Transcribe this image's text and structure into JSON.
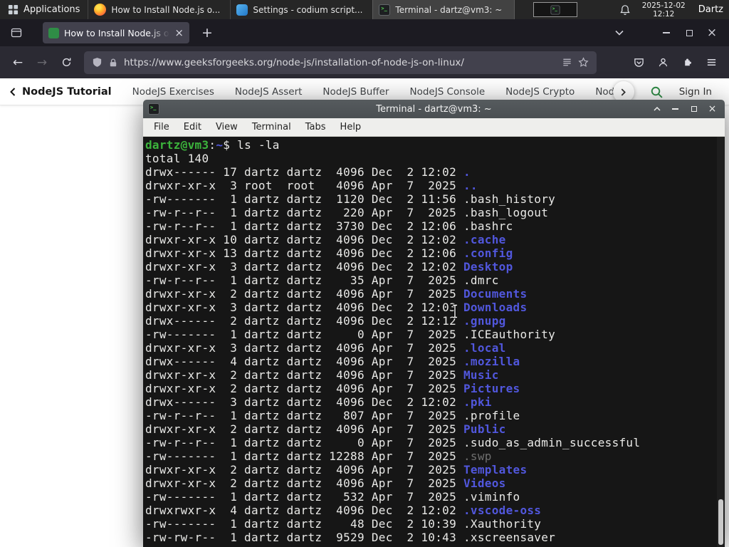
{
  "colors": {
    "panel_bg": "#262626",
    "tabbar_bg": "#1c1b22",
    "toolbar_bg": "#2b2a33",
    "urlbar_bg": "#42414d",
    "gfg_green": "#2f8d46",
    "titlebar_bg": "#4a4f52",
    "menubar_bg": "#eeeeec",
    "term_bg": "#161616",
    "term_fg": "#e9e9e7",
    "term_green": "#3cb43c",
    "term_blue": "#5157dd",
    "term_dim": "#6f6f6f"
  },
  "glyphs": {
    "close": "×",
    "plus": "+",
    "back": "←",
    "forward": "→"
  },
  "panel": {
    "applications_label": "Applications",
    "tasks": [
      {
        "label": "How to Install Node.js o...",
        "icon": "firefox-icon"
      },
      {
        "label": "Settings - codium script...",
        "icon": "codium-icon"
      },
      {
        "label": "Terminal - dartz@vm3: ~",
        "icon": "terminal-icon"
      }
    ],
    "clock_date": "2025-12-02",
    "clock_time": "12:12",
    "user": "Dartz"
  },
  "browser": {
    "tab_title": "How to Install Node.js on",
    "url": "https://www.geeksforgeeks.org/node-js/installation-of-node-js-on-linux/"
  },
  "gfg": {
    "primary": "NodeJS Tutorial",
    "links": [
      "NodeJS Exercises",
      "NodeJS Assert",
      "NodeJS Buffer",
      "NodeJS Console",
      "NodeJS Crypto",
      "NodeJS DNS",
      "Node"
    ],
    "sign_in": "Sign In"
  },
  "terminal_window": {
    "title": "Terminal - dartz@vm3: ~",
    "menus": [
      "File",
      "Edit",
      "View",
      "Terminal",
      "Tabs",
      "Help"
    ]
  },
  "terminal": {
    "prompt": "dartz@vm3:~$",
    "command": "ls -la",
    "lines": [
      [
        {
          "t": "dartz@vm3",
          "c": "green"
        },
        {
          "t": ":",
          "c": "fg"
        },
        {
          "t": "~",
          "c": "blue"
        },
        {
          "t": "$ ls -la",
          "c": "fg"
        }
      ],
      [
        {
          "t": "total 140",
          "c": "fg"
        }
      ],
      [
        {
          "t": "drwx------ 17 dartz dartz  4096 Dec  2 12:02 ",
          "c": "fg"
        },
        {
          "t": ".",
          "c": "blue"
        }
      ],
      [
        {
          "t": "drwxr-xr-x  3 root  root   4096 Apr  7  2025 ",
          "c": "fg"
        },
        {
          "t": "..",
          "c": "blue"
        }
      ],
      [
        {
          "t": "-rw-------  1 dartz dartz  1120 Dec  2 11:56 .bash_history",
          "c": "fg"
        }
      ],
      [
        {
          "t": "-rw-r--r--  1 dartz dartz   220 Apr  7  2025 .bash_logout",
          "c": "fg"
        }
      ],
      [
        {
          "t": "-rw-r--r--  1 dartz dartz  3730 Dec  2 12:06 .bashrc",
          "c": "fg"
        }
      ],
      [
        {
          "t": "drwxr-xr-x 10 dartz dartz  4096 Dec  2 12:02 ",
          "c": "fg"
        },
        {
          "t": ".cache",
          "c": "blue"
        }
      ],
      [
        {
          "t": "drwxr-xr-x 13 dartz dartz  4096 Dec  2 12:06 ",
          "c": "fg"
        },
        {
          "t": ".config",
          "c": "blue"
        }
      ],
      [
        {
          "t": "drwxr-xr-x  3 dartz dartz  4096 Dec  2 12:02 ",
          "c": "fg"
        },
        {
          "t": "Desktop",
          "c": "blue"
        }
      ],
      [
        {
          "t": "-rw-r--r--  1 dartz dartz    35 Apr  7  2025 .dmrc",
          "c": "fg"
        }
      ],
      [
        {
          "t": "drwxr-xr-x  2 dartz dartz  4096 Apr  7  2025 ",
          "c": "fg"
        },
        {
          "t": "Documents",
          "c": "blue"
        }
      ],
      [
        {
          "t": "drwxr-xr-x  3 dartz dartz  4096 Dec  2 12:03 ",
          "c": "fg"
        },
        {
          "t": "Downloads",
          "c": "blue"
        }
      ],
      [
        {
          "t": "drwx------  2 dartz dartz  4096 Dec  2 12:12 ",
          "c": "fg"
        },
        {
          "t": ".gnupg",
          "c": "blue"
        }
      ],
      [
        {
          "t": "-rw-------  1 dartz dartz     0 Apr  7  2025 .ICEauthority",
          "c": "fg"
        }
      ],
      [
        {
          "t": "drwxr-xr-x  3 dartz dartz  4096 Apr  7  2025 ",
          "c": "fg"
        },
        {
          "t": ".local",
          "c": "blue"
        }
      ],
      [
        {
          "t": "drwx------  4 dartz dartz  4096 Apr  7  2025 ",
          "c": "fg"
        },
        {
          "t": ".mozilla",
          "c": "blue"
        }
      ],
      [
        {
          "t": "drwxr-xr-x  2 dartz dartz  4096 Apr  7  2025 ",
          "c": "fg"
        },
        {
          "t": "Music",
          "c": "blue"
        }
      ],
      [
        {
          "t": "drwxr-xr-x  2 dartz dartz  4096 Apr  7  2025 ",
          "c": "fg"
        },
        {
          "t": "Pictures",
          "c": "blue"
        }
      ],
      [
        {
          "t": "drwx------  3 dartz dartz  4096 Dec  2 12:02 ",
          "c": "fg"
        },
        {
          "t": ".pki",
          "c": "blue"
        }
      ],
      [
        {
          "t": "-rw-r--r--  1 dartz dartz   807 Apr  7  2025 .profile",
          "c": "fg"
        }
      ],
      [
        {
          "t": "drwxr-xr-x  2 dartz dartz  4096 Apr  7  2025 ",
          "c": "fg"
        },
        {
          "t": "Public",
          "c": "blue"
        }
      ],
      [
        {
          "t": "-rw-r--r--  1 dartz dartz     0 Apr  7  2025 .sudo_as_admin_successful",
          "c": "fg"
        }
      ],
      [
        {
          "t": "-rw-------  1 dartz dartz 12288 Apr  7  2025 ",
          "c": "fg"
        },
        {
          "t": ".swp",
          "c": "dim"
        }
      ],
      [
        {
          "t": "drwxr-xr-x  2 dartz dartz  4096 Apr  7  2025 ",
          "c": "fg"
        },
        {
          "t": "Templates",
          "c": "blue"
        }
      ],
      [
        {
          "t": "drwxr-xr-x  2 dartz dartz  4096 Apr  7  2025 ",
          "c": "fg"
        },
        {
          "t": "Videos",
          "c": "blue"
        }
      ],
      [
        {
          "t": "-rw-------  1 dartz dartz   532 Apr  7  2025 .viminfo",
          "c": "fg"
        }
      ],
      [
        {
          "t": "drwxrwxr-x  4 dartz dartz  4096 Dec  2 12:02 ",
          "c": "fg"
        },
        {
          "t": ".vscode-oss",
          "c": "blue"
        }
      ],
      [
        {
          "t": "-rw-------  1 dartz dartz    48 Dec  2 10:39 .Xauthority",
          "c": "fg"
        }
      ],
      [
        {
          "t": "-rw-rw-r--  1 dartz dartz  9529 Dec  2 10:43 .xscreensaver",
          "c": "fg"
        }
      ]
    ]
  }
}
